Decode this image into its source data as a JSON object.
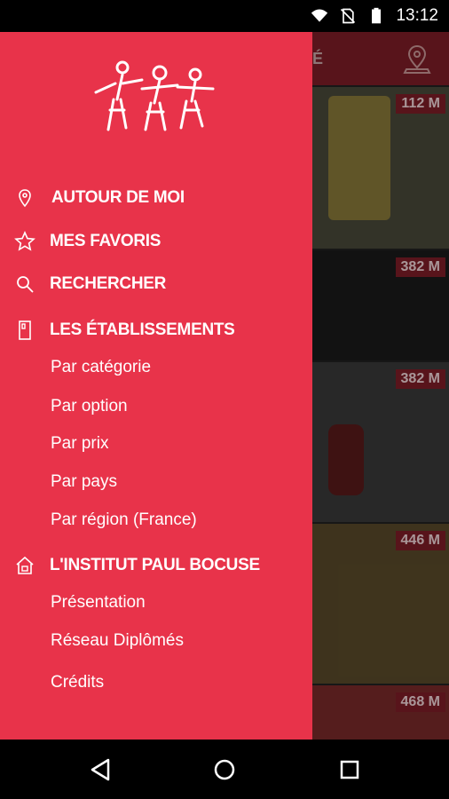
{
  "status_bar": {
    "time": "13:12",
    "icons": [
      "wifi-icon",
      "no-sim-icon",
      "battery-icon"
    ]
  },
  "background": {
    "header_title": "TÉ",
    "header_icon": "location-pin-icon",
    "cards": [
      {
        "distance": "112 M",
        "color": "#4a4a3a"
      },
      {
        "distance": "382 M",
        "color": "#1b1b1b"
      },
      {
        "distance": "382 M",
        "color": "#3a3a3a"
      },
      {
        "distance": "446 M",
        "color": "#5a4a2a"
      },
      {
        "distance": "468 M",
        "color": "#7a2a2a"
      }
    ]
  },
  "drawer": {
    "accent_color": "#e8334a",
    "menu": [
      {
        "label": "AUTOUR DE MOI",
        "icon": "location-icon"
      },
      {
        "label": "MES FAVORIS",
        "icon": "star-icon"
      },
      {
        "label": "RECHERCHER",
        "icon": "search-icon"
      },
      {
        "label": "LES ÉTABLISSEMENTS",
        "icon": "building-icon"
      }
    ],
    "etablissements_sub": [
      "Par catégorie",
      "Par option",
      "Par prix",
      "Par pays",
      "Par région (France)"
    ],
    "institut": {
      "label": "L'INSTITUT PAUL BOCUSE",
      "icon": "home-icon"
    },
    "institut_sub": [
      "Présentation",
      "Réseau Diplômés"
    ],
    "credits": "Crédits"
  },
  "nav_bar": {
    "icons": [
      "back-icon",
      "home-icon",
      "recents-icon"
    ]
  }
}
